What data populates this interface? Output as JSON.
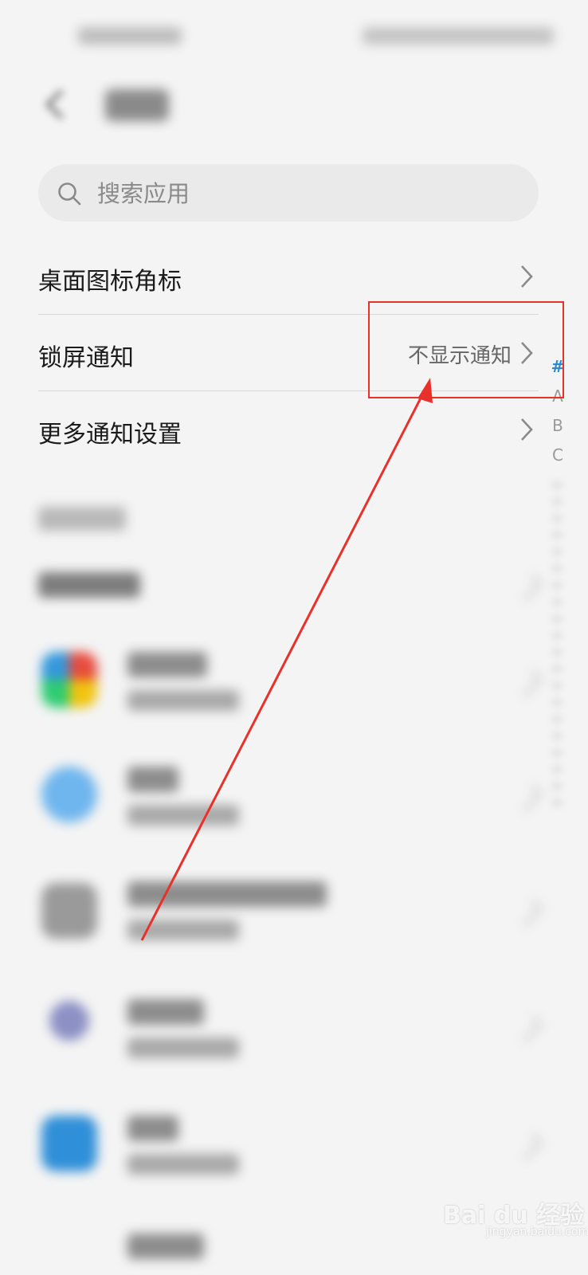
{
  "search": {
    "placeholder": "搜索应用"
  },
  "settings": {
    "badge_label": "桌面图标角标",
    "lockscreen_label": "锁屏通知",
    "lockscreen_value": "不显示通知",
    "more_label": "更多通知设置"
  },
  "index_letters": [
    "#",
    "A",
    "B",
    "C"
  ],
  "colors": {
    "accent": "#2a8ad6",
    "annotation": "#e8312a"
  },
  "watermark": {
    "text": "Bai du 经验",
    "sub": "jingyan.baidu.com"
  }
}
